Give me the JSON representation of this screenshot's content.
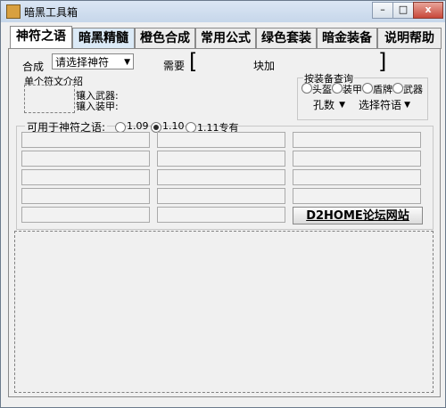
{
  "window": {
    "title": "暗黑工具箱",
    "min_glyph": "–",
    "max_glyph": "□",
    "close_glyph": "x"
  },
  "tabs": [
    {
      "label": "神符之语"
    },
    {
      "label": "暗黑精髓"
    },
    {
      "label": "橙色合成"
    },
    {
      "label": "常用公式"
    },
    {
      "label": "绿色套装"
    },
    {
      "label": "暗金装备"
    },
    {
      "label": "说明帮助"
    }
  ],
  "compose": {
    "label": "合成",
    "select_value": "请选择神符",
    "need_label": "需要",
    "bracket_left": "[",
    "bracket_right": "]",
    "unit": "块加"
  },
  "rune_intro": {
    "label": "单个符文介绍",
    "weapon_label": "镶入武器:",
    "armor_label": "镶入装甲:"
  },
  "equip_query": {
    "label": "按装备查询",
    "options": [
      "头盔",
      "装甲",
      "盾牌",
      "武器"
    ],
    "sockets_value": "孔数",
    "runeword_value": "选择符语"
  },
  "version": {
    "label": "可用于神符之语:",
    "options": [
      "1.09",
      "1.10",
      "1.11专有"
    ],
    "selected_index": 1
  },
  "link_button": {
    "label": "D2HOME论坛网站"
  }
}
